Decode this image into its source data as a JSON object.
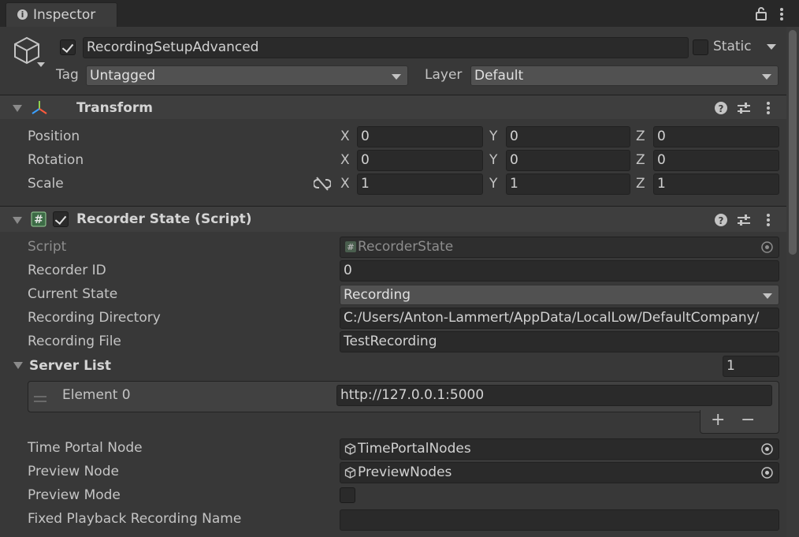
{
  "window": {
    "tab_title": "Inspector"
  },
  "header": {
    "object_name": "RecordingSetupAdvanced",
    "active": true,
    "static_label": "Static",
    "static_checked": false,
    "tag_label": "Tag",
    "tag_value": "Untagged",
    "layer_label": "Layer",
    "layer_value": "Default"
  },
  "transform": {
    "title": "Transform",
    "rows": [
      {
        "label": "Position",
        "x": "0",
        "y": "0",
        "z": "0"
      },
      {
        "label": "Rotation",
        "x": "0",
        "y": "0",
        "z": "0"
      },
      {
        "label": "Scale",
        "x": "1",
        "y": "1",
        "z": "1"
      }
    ],
    "axis": {
      "x": "X",
      "y": "Y",
      "z": "Z"
    }
  },
  "recorder": {
    "title": "Recorder State (Script)",
    "enabled": true,
    "script_label": "Script",
    "script_value": "RecorderState",
    "recorder_id_label": "Recorder ID",
    "recorder_id_value": "0",
    "current_state_label": "Current State",
    "current_state_value": "Recording",
    "recording_directory_label": "Recording Directory",
    "recording_directory_value": "C:/Users/Anton-Lammert/AppData/LocalLow/DefaultCompany/",
    "recording_file_label": "Recording File",
    "recording_file_value": "TestRecording",
    "server_list_label": "Server List",
    "server_list_size": "1",
    "server_elements": [
      {
        "label": "Element 0",
        "value": "http://127.0.0.1:5000"
      }
    ],
    "plus_label": "+",
    "minus_label": "−",
    "time_portal_node_label": "Time Portal Node",
    "time_portal_node_value": "TimePortalNodes",
    "preview_node_label": "Preview Node",
    "preview_node_value": "PreviewNodes",
    "preview_mode_label": "Preview Mode",
    "preview_mode_checked": false,
    "fixed_playback_label": "Fixed Playback Recording Name",
    "fixed_playback_value": ""
  },
  "icons": [
    "info-icon",
    "lock-icon",
    "kebab-menu-icon",
    "gameobject-cube-icon",
    "transform-axes-icon",
    "help-icon",
    "preset-sliders-icon",
    "script-hash-icon",
    "unlink-icon",
    "object-picker-icon"
  ],
  "colors": {
    "background": "#383838",
    "field": "#2a2a2a",
    "dropdown": "#515151",
    "text": "#c4c4c4"
  }
}
